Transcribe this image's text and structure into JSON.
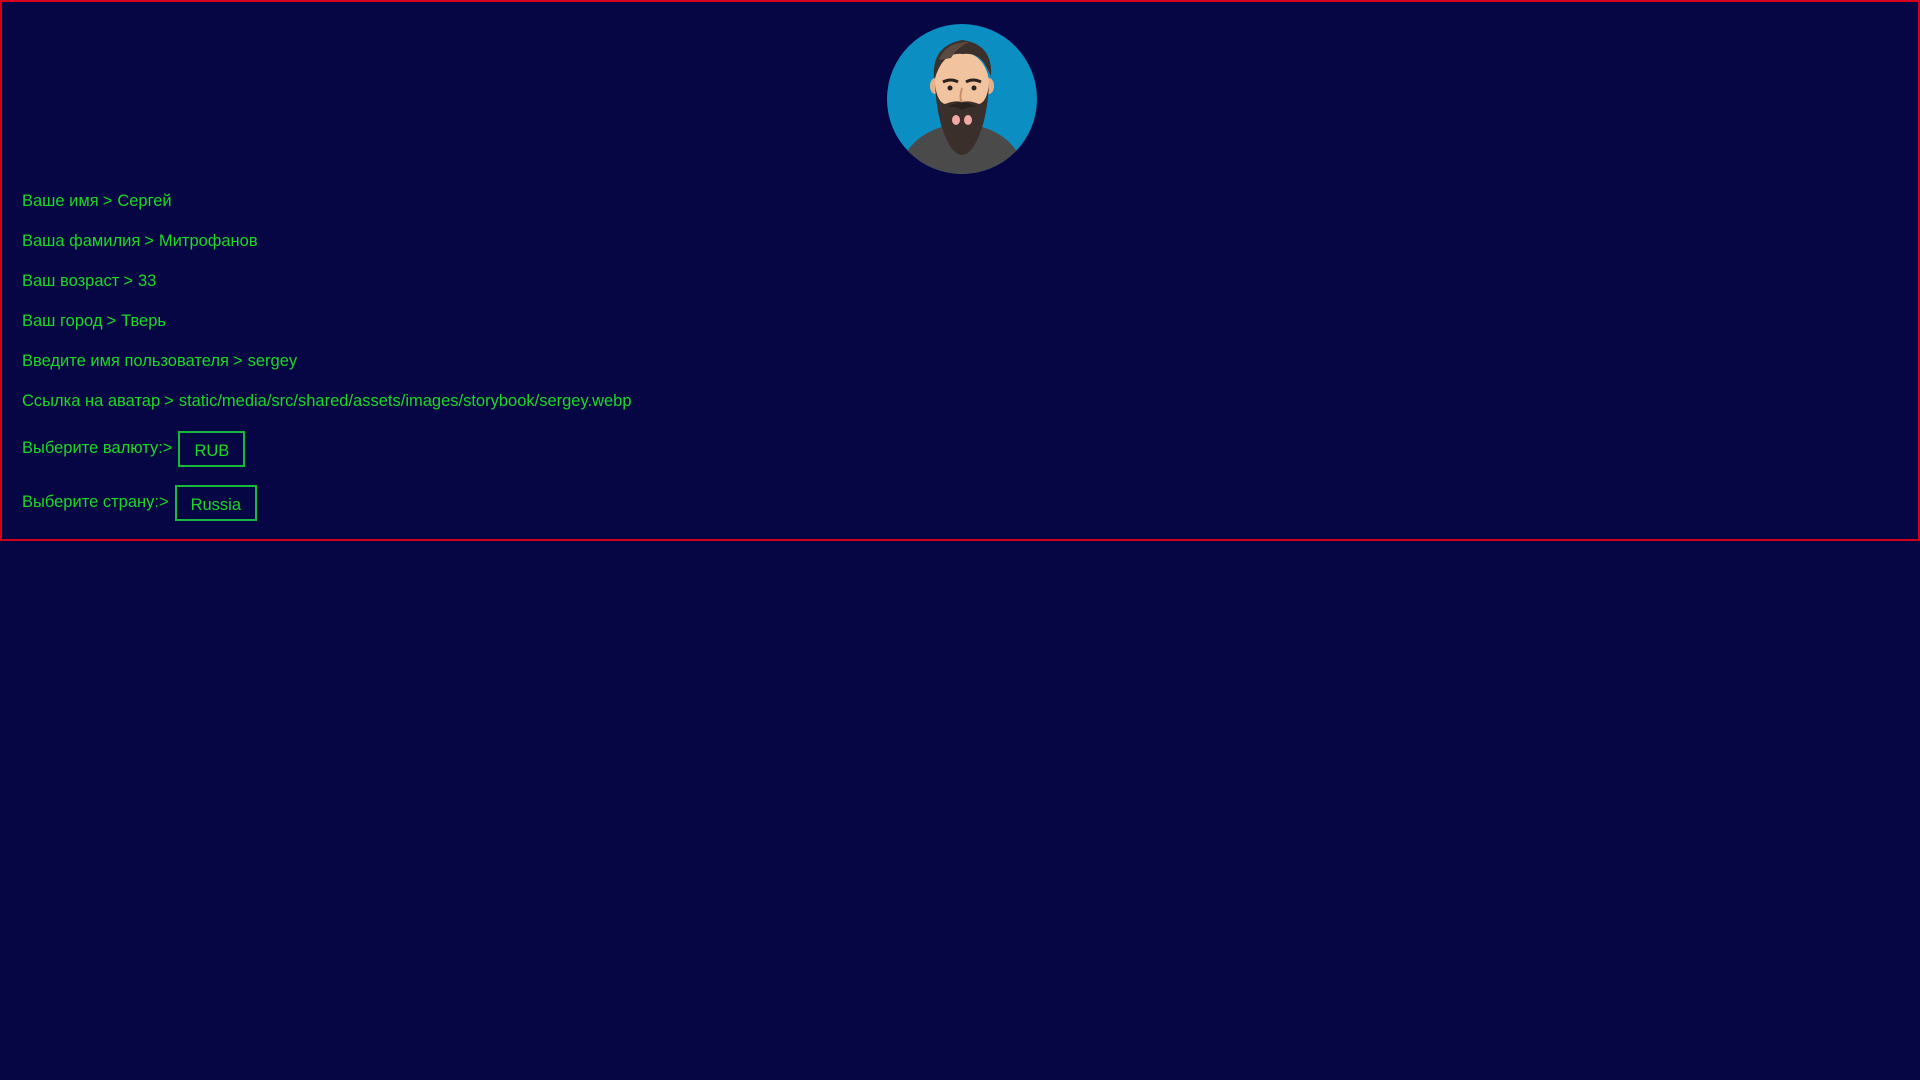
{
  "profile": {
    "avatar": "avatar-bearded-man",
    "fields": [
      {
        "label": "Ваше имя",
        "separator": ">",
        "value": "Сергей"
      },
      {
        "label": "Ваша фамилия",
        "separator": ">",
        "value": "Митрофанов"
      },
      {
        "label": "Ваш возраст",
        "separator": ">",
        "value": "33"
      },
      {
        "label": "Ваш город",
        "separator": ">",
        "value": "Тверь"
      },
      {
        "label": "Введите имя пользователя",
        "separator": ">",
        "value": "sergey"
      },
      {
        "label": "Ссылка на аватар",
        "separator": ">",
        "value": "static/media/src/shared/assets/images/storybook/sergey.webp"
      }
    ],
    "currency": {
      "label": "Выберите валюту:>",
      "value": "RUB"
    },
    "country": {
      "label": "Выберите страну:>",
      "value": "Russia"
    }
  },
  "colors": {
    "background": "#070644",
    "text": "#19d826",
    "border": "#d3001c",
    "select_border": "#17b93a",
    "avatar_bg": "#0b8fc3"
  }
}
